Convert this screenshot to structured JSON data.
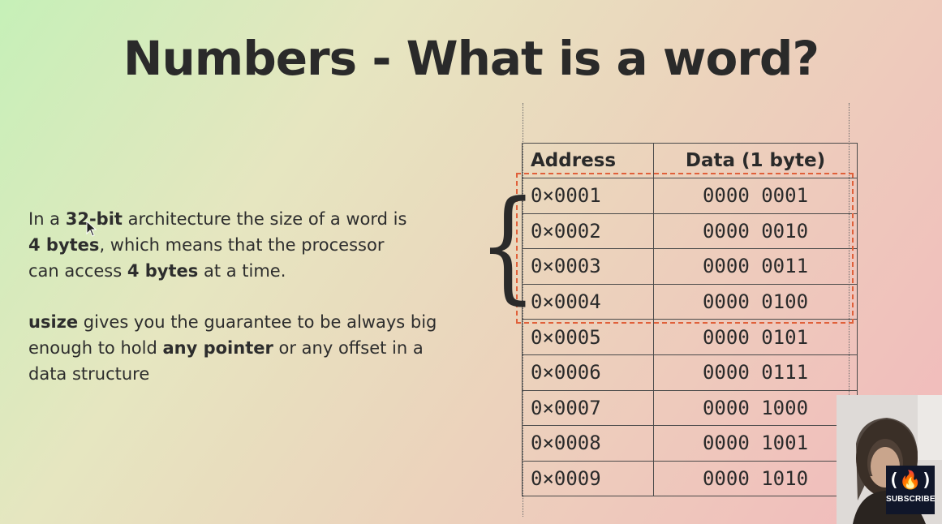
{
  "slide": {
    "title": "Numbers - What is a word?",
    "paragraph1": {
      "l1": {
        "a": "In a ",
        "b": "32-bit",
        "c": " architecture the size of a word is"
      },
      "l2": {
        "b": "4 bytes",
        "c": ", which means that the processor"
      },
      "l3": {
        "a": "can access ",
        "b": "4 bytes",
        "c": " at a time."
      }
    },
    "paragraph2": {
      "l1": {
        "b": "usize",
        "c": " gives you the guarantee to be always big"
      },
      "l2": {
        "a": "enough to hold ",
        "b": "any pointer",
        "c": " or any offset in a"
      },
      "l3": {
        "a": "data structure"
      }
    }
  },
  "table": {
    "headers": {
      "address": "Address",
      "data": "Data (1 byte)"
    },
    "rows": [
      {
        "addr": "0×0001",
        "data": "0000 0001"
      },
      {
        "addr": "0×0002",
        "data": "0000 0010"
      },
      {
        "addr": "0×0003",
        "data": "0000 0011"
      },
      {
        "addr": "0×0004",
        "data": "0000 0100"
      },
      {
        "addr": "0×0005",
        "data": "0000 0101"
      },
      {
        "addr": "0×0006",
        "data": "0000 0111"
      },
      {
        "addr": "0×0007",
        "data": "0000 1000"
      },
      {
        "addr": "0×0008",
        "data": "0000 1001"
      },
      {
        "addr": "0×0009",
        "data": "0000 1010"
      }
    ],
    "highlight_color": "#e0603a"
  },
  "overlay": {
    "brace": "{",
    "logo_glyph": "(🔥)",
    "subscribe": "SUBSCRIBE"
  }
}
